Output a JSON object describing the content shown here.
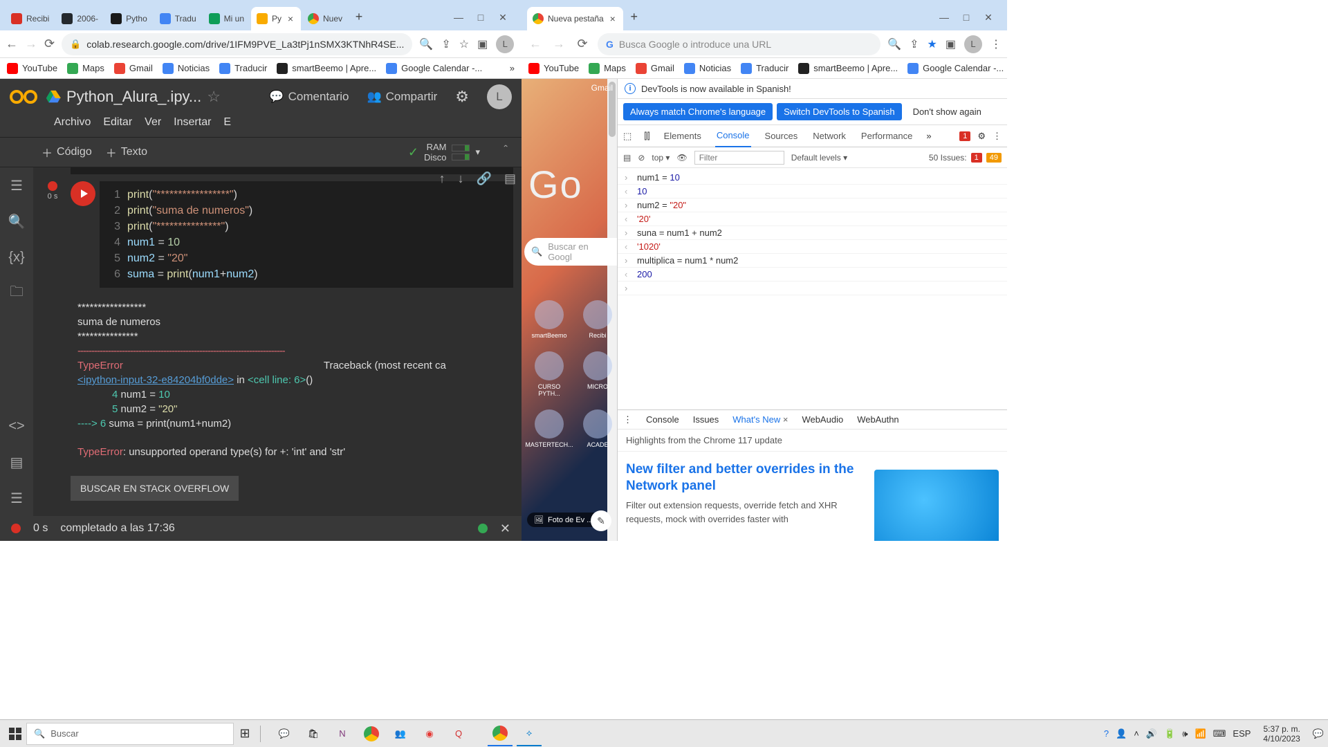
{
  "left_window": {
    "tabs": [
      {
        "label": "Recibi",
        "color": "#d93025"
      },
      {
        "label": "2006-",
        "color": "#24292e"
      },
      {
        "label": "Pytho",
        "color": "#1a1a1a"
      },
      {
        "label": "Tradu",
        "color": "#4285f4"
      },
      {
        "label": "Mi un",
        "color": "#0f9d58"
      }
    ],
    "active_tab": {
      "label": "Py",
      "close": "×"
    },
    "inactive_tab_right": {
      "label": "Nuev"
    },
    "url": "colab.research.google.com/drive/1IFM9PVE_La3tPj1nSMX3KTNhR4SE...",
    "bookmarks": [
      "YouTube",
      "Maps",
      "Gmail",
      "Noticias",
      "Traducir",
      "smartBeemo | Apre...",
      "Google Calendar -..."
    ]
  },
  "right_window": {
    "active_tab": {
      "label": "Nueva pestaña"
    },
    "url_placeholder": "Busca Google o introduce una URL",
    "bookmarks": [
      "YouTube",
      "Maps",
      "Gmail",
      "Noticias",
      "Traducir",
      "smartBeemo | Apre...",
      "Google Calendar -..."
    ]
  },
  "colab": {
    "title": "Python_Alura_.ipy...",
    "actions": {
      "comment": "Comentario",
      "share": "Compartir"
    },
    "menus": [
      "Archivo",
      "Editar",
      "Ver",
      "Insertar",
      "E"
    ],
    "add_code": "Código",
    "add_text": "Texto",
    "resources": {
      "ram": "RAM",
      "disk": "Disco"
    },
    "avatar_letter": "L",
    "status_time": "0 s",
    "cell_status_time": "0 s",
    "code": [
      {
        "n": "1",
        "body": [
          [
            "func",
            "print"
          ],
          [
            "op",
            "("
          ],
          [
            "str",
            "\"*****************\""
          ],
          [
            "op",
            ")"
          ]
        ]
      },
      {
        "n": "2",
        "body": [
          [
            "func",
            "print"
          ],
          [
            "op",
            "("
          ],
          [
            "str",
            "\"suma de numeros\""
          ],
          [
            "op",
            ")"
          ]
        ]
      },
      {
        "n": "3",
        "body": [
          [
            "func",
            "print"
          ],
          [
            "op",
            "("
          ],
          [
            "str",
            "\"***************\""
          ],
          [
            "op",
            ")"
          ]
        ]
      },
      {
        "n": "4",
        "body": [
          [
            "var",
            "num1"
          ],
          [
            "op",
            " = "
          ],
          [
            "num",
            "10"
          ]
        ]
      },
      {
        "n": "5",
        "body": [
          [
            "var",
            "num2"
          ],
          [
            "op",
            " = "
          ],
          [
            "str",
            "\"20\""
          ]
        ]
      },
      {
        "n": "6",
        "body": [
          [
            "var",
            "suma"
          ],
          [
            "op",
            " = "
          ],
          [
            "func",
            "print"
          ],
          [
            "op",
            "("
          ],
          [
            "var",
            "num1"
          ],
          [
            "op",
            "+"
          ],
          [
            "var",
            "num2"
          ],
          [
            "op",
            ")"
          ]
        ]
      }
    ],
    "output": {
      "stars1": "*****************",
      "title": "suma de numeros",
      "stars2": "***************",
      "hr": "---------------------------------------------------------------------------",
      "error_cls": "TypeError",
      "traceback_head": "Traceback (most recent ca",
      "ipython_link": "<ipython-input-32-e84204bf0dde>",
      "in_cell": " in ",
      "cell_line": "<cell line: 6>",
      "paren": "()",
      "tb_l1_num": "4",
      "tb_l1": "num1 = ",
      "tb_l1_val": "10",
      "tb_l2_num": "5",
      "tb_l2": "num2 = ",
      "tb_l2_val": "\"20\"",
      "tb_arrow": "----> ",
      "tb_l3_num": "6",
      "tb_l3": " suma = print(num1+num2)",
      "error_msg": ": unsupported operand type(s) for +: 'int' and 'str'",
      "so_button": "BUSCAR EN STACK OVERFLOW"
    },
    "statusbar": {
      "time": "0 s",
      "msg": "completado a las 17:36"
    }
  },
  "newtab": {
    "gmail": "Gmail",
    "logo": "Go",
    "search_placeholder": "Buscar en Googl",
    "apps": [
      "smartBeemo",
      "Recibi",
      "CURSO PYTH...",
      "MICRO",
      "MASTERTECH...",
      "ACADE"
    ],
    "photo_label": "Foto de Ev ..."
  },
  "devtools": {
    "notice": "DevTools is now available in Spanish!",
    "btn_match": "Always match Chrome's language",
    "btn_switch": "Switch DevTools to Spanish",
    "btn_dont": "Don't show again",
    "tabs": [
      "Elements",
      "Console",
      "Sources",
      "Network",
      "Performance"
    ],
    "active_tab": "Console",
    "err_count": "1",
    "filter": {
      "context": "top",
      "placeholder": "Filter",
      "levels": "Default levels",
      "issues_label": "50 Issues:",
      "err": "1",
      "warn": "49"
    },
    "logs": [
      {
        "type": "in",
        "content": [
          [
            "var",
            "num1"
          ],
          [
            "op",
            " = "
          ],
          [
            "num",
            "10"
          ]
        ]
      },
      {
        "type": "out",
        "content": [
          [
            "num",
            "10"
          ]
        ]
      },
      {
        "type": "in",
        "content": [
          [
            "var",
            "num2"
          ],
          [
            "op",
            " = "
          ],
          [
            "str",
            "\"20\""
          ]
        ]
      },
      {
        "type": "out",
        "content": [
          [
            "str",
            "'20'"
          ]
        ]
      },
      {
        "type": "in",
        "content": [
          [
            "var",
            "suna"
          ],
          [
            "op",
            " = "
          ],
          [
            "var",
            "num1"
          ],
          [
            "op",
            " + "
          ],
          [
            "var",
            "num2"
          ]
        ]
      },
      {
        "type": "out",
        "content": [
          [
            "str",
            "'1020'"
          ]
        ]
      },
      {
        "type": "in",
        "content": [
          [
            "var",
            "multiplica"
          ],
          [
            "op",
            " = "
          ],
          [
            "var",
            "num1"
          ],
          [
            "op",
            " * "
          ],
          [
            "var",
            "num2"
          ]
        ]
      },
      {
        "type": "out",
        "content": [
          [
            "num",
            "200"
          ]
        ]
      },
      {
        "type": "in",
        "content": []
      }
    ],
    "drawer": {
      "tabs": [
        "Console",
        "Issues",
        "What's New",
        "WebAudio",
        "WebAuthn"
      ],
      "active": "What's New",
      "subtitle": "Highlights from the Chrome 117 update",
      "headline": "New filter and better overrides in the Network panel",
      "body": "Filter out extension requests, override fetch and XHR requests, mock with overrides faster with"
    }
  },
  "taskbar": {
    "search_placeholder": "Buscar",
    "lang": "ESP",
    "time": "5:37 p. m.",
    "date": "4/10/2023"
  }
}
